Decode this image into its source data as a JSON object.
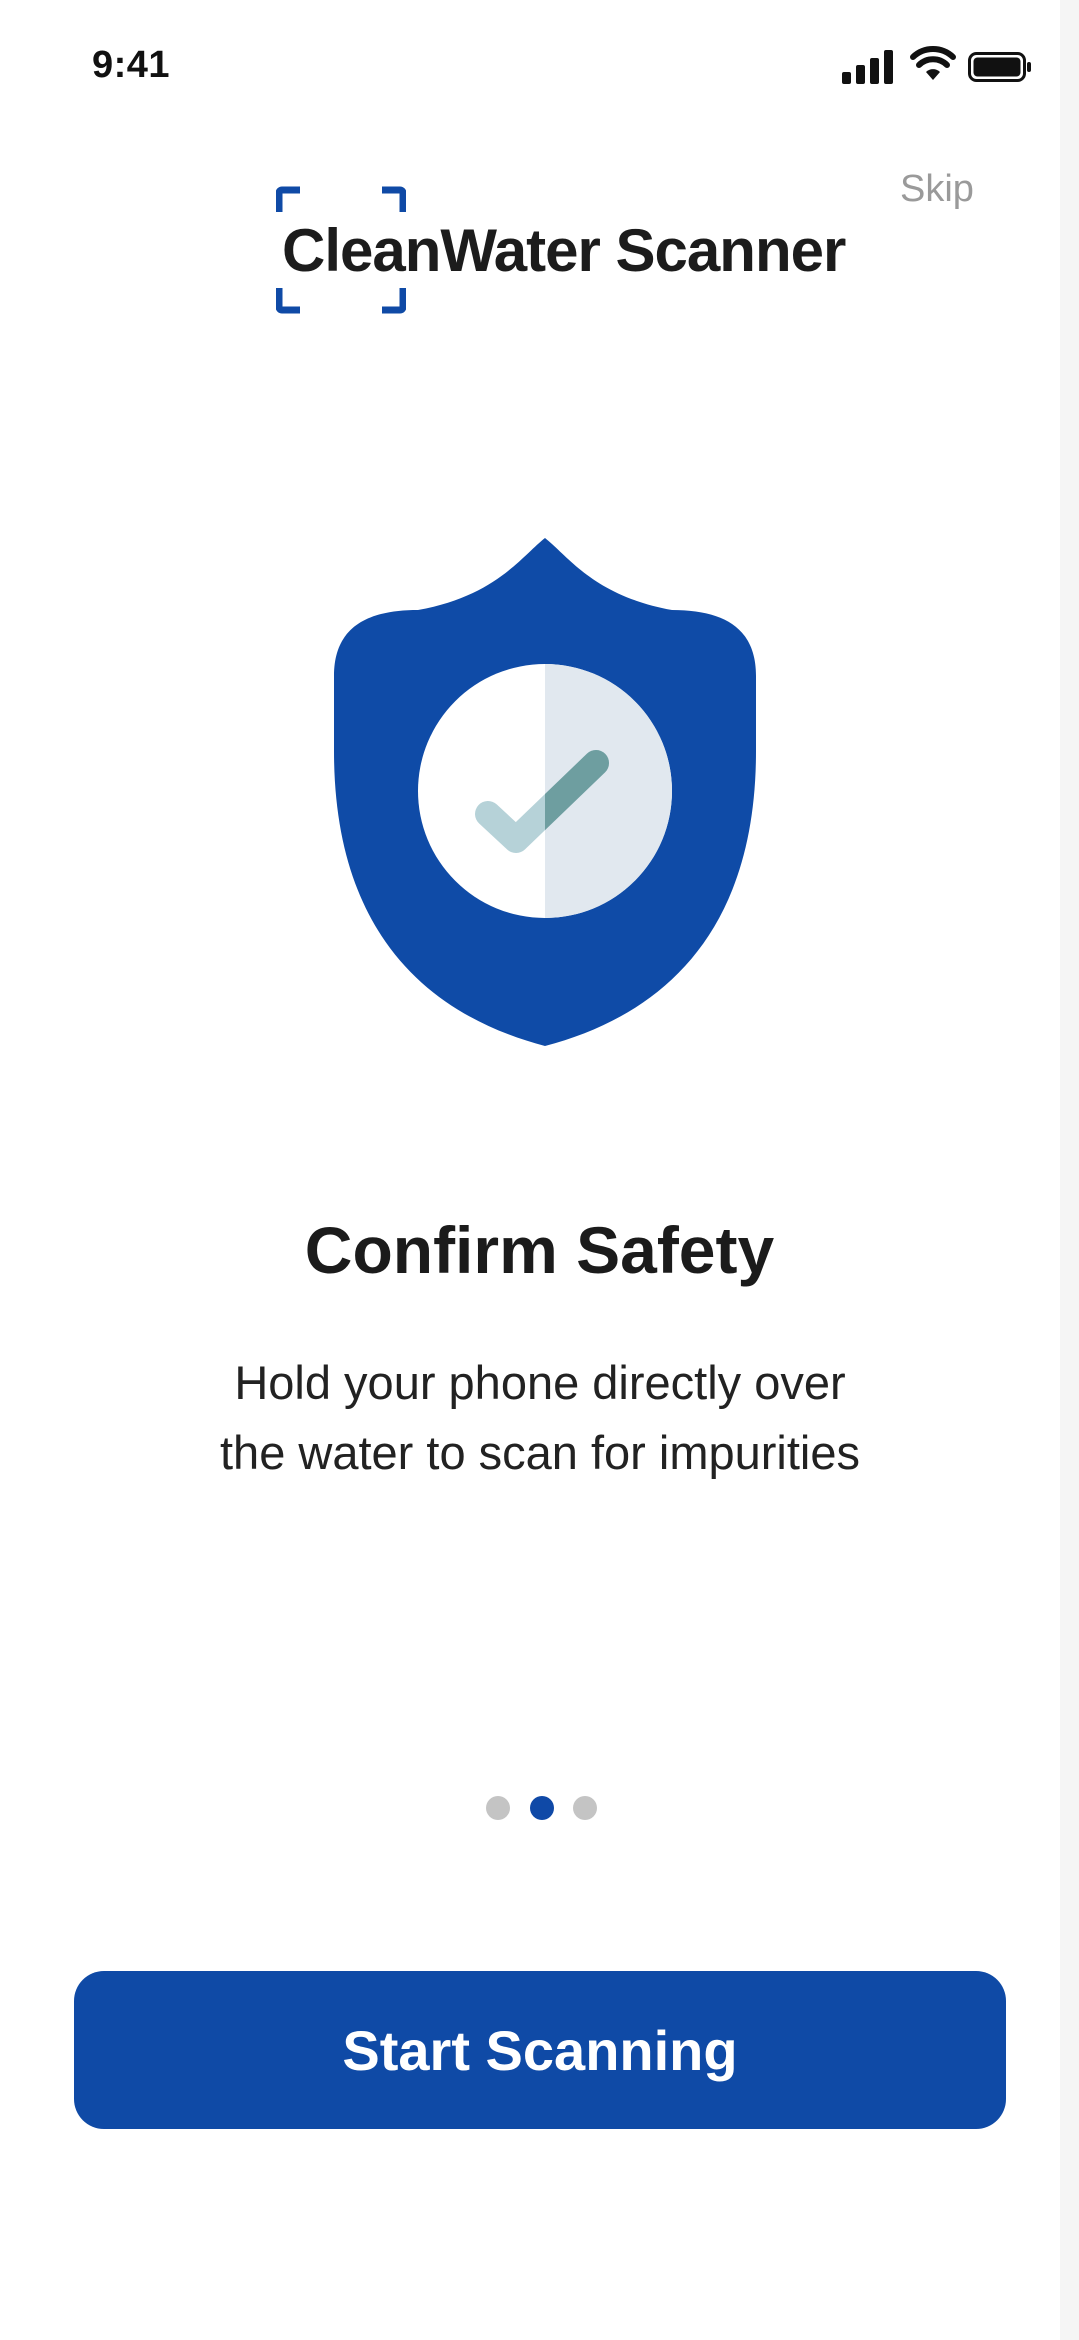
{
  "status_bar": {
    "time": "9:41",
    "icons": [
      "signal-icon",
      "wifi-icon",
      "battery-icon"
    ]
  },
  "header": {
    "skip_label": "Skip",
    "logo_text": "CleanWater Scanner",
    "logo_icon": "scan-frame-icon"
  },
  "onboarding": {
    "illustration": "shield-check-icon",
    "title": "Confirm Safety",
    "description_line1": "Hold your phone directly over",
    "description_line2": "the water to scan for impurities",
    "page_count": 3,
    "current_page": 2
  },
  "cta": {
    "label": "Start Scanning"
  },
  "colors": {
    "brand_blue": "#0F4AA6",
    "inactive_dot": "#C4C4C4",
    "check_teal": "#6E9EA0",
    "skip_gray": "#9A9A9A"
  }
}
